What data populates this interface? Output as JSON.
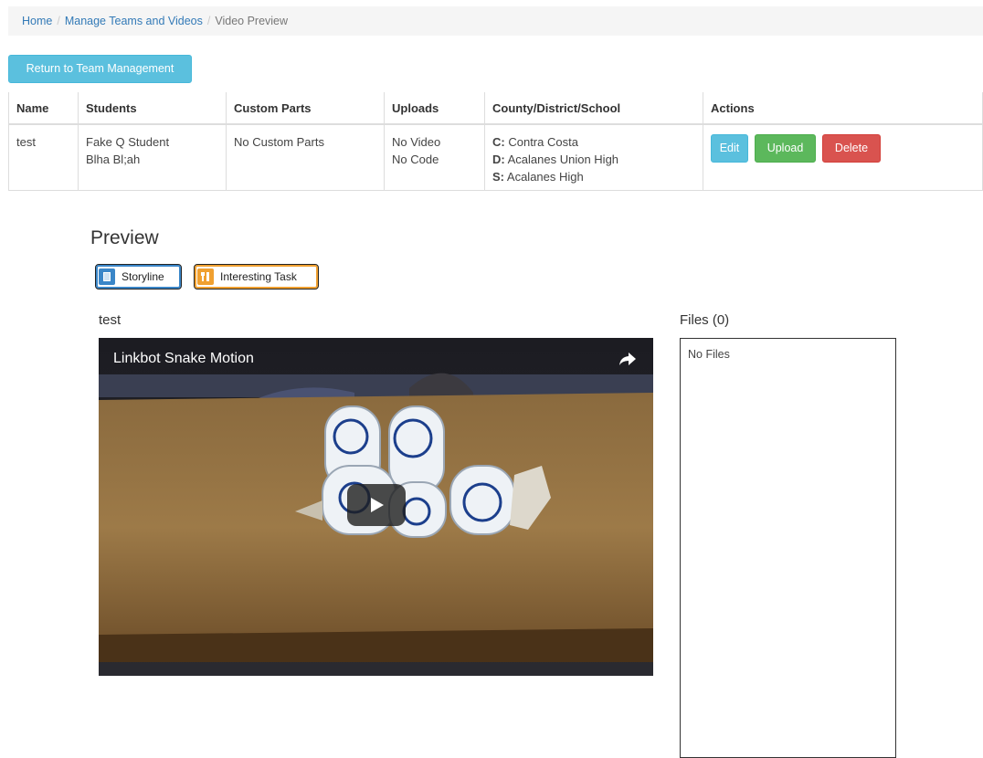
{
  "breadcrumb": {
    "items": [
      "Home",
      "Manage Teams and Videos"
    ],
    "current": "Video Preview",
    "separator": "/"
  },
  "return_button": "Return to Team Management",
  "table": {
    "headers": [
      "Name",
      "Students",
      "Custom Parts",
      "Uploads",
      "County/District/School",
      "Actions"
    ],
    "row": {
      "name": "test",
      "students": [
        "Fake Q Student",
        "Blha Bl;ah"
      ],
      "custom_parts": "No Custom Parts",
      "uploads": [
        "No Video",
        "No Code"
      ],
      "location": {
        "county_label": "C:",
        "county": "Contra Costa",
        "district_label": "D:",
        "district": "Acalanes Union High",
        "school_label": "S:",
        "school": "Acalanes High"
      },
      "actions": {
        "edit": "Edit",
        "upload": "Upload",
        "delete": "Delete"
      }
    }
  },
  "preview": {
    "title": "Preview",
    "tags": [
      {
        "label": "Storyline",
        "icon": "book-icon",
        "color": "#3a86c8"
      },
      {
        "label": "Interesting Task",
        "icon": "utensils-icon",
        "color": "#f0a030"
      }
    ],
    "video_title": "test",
    "video_caption": "Linkbot Snake Motion"
  },
  "files": {
    "title": "Files (0)",
    "empty_text": "No Files"
  },
  "colors": {
    "info": "#5bc0de",
    "success": "#5cb85c",
    "danger": "#d9534f",
    "link": "#337ab7"
  }
}
